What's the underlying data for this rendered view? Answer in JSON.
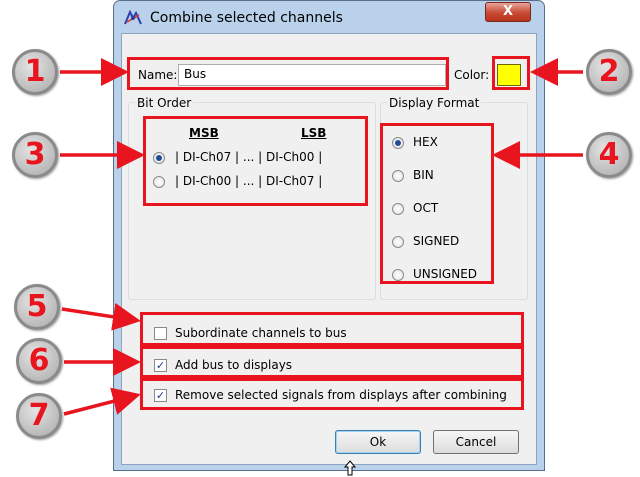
{
  "dialog": {
    "title": "Combine selected channels",
    "close_label": "X"
  },
  "name_field": {
    "label": "Name:",
    "value": "Bus"
  },
  "color": {
    "label": "Color:",
    "value": "#ffff00"
  },
  "bit_order": {
    "title": "Bit Order",
    "msb_header": "MSB",
    "lsb_header": "LSB",
    "options": [
      {
        "selected": true,
        "msb": "DI-Ch07",
        "ellipsis": "...",
        "lsb": "DI-Ch00"
      },
      {
        "selected": false,
        "msb": "DI-Ch00",
        "ellipsis": "...",
        "lsb": "DI-Ch07"
      }
    ]
  },
  "display_format": {
    "title": "Display Format",
    "options": [
      {
        "label": "HEX",
        "selected": true
      },
      {
        "label": "BIN",
        "selected": false
      },
      {
        "label": "OCT",
        "selected": false
      },
      {
        "label": "SIGNED",
        "selected": false
      },
      {
        "label": "UNSIGNED",
        "selected": false
      }
    ]
  },
  "checkboxes": [
    {
      "label": "Subordinate channels to bus",
      "checked": false
    },
    {
      "label": "Add bus to displays",
      "checked": true
    },
    {
      "label": "Remove selected signals from displays after combining",
      "checked": true
    }
  ],
  "buttons": {
    "ok": "Ok",
    "cancel": "Cancel"
  },
  "annotations": {
    "color": "#e8141e",
    "badges": [
      "1",
      "2",
      "3",
      "4",
      "5",
      "6",
      "7"
    ]
  }
}
